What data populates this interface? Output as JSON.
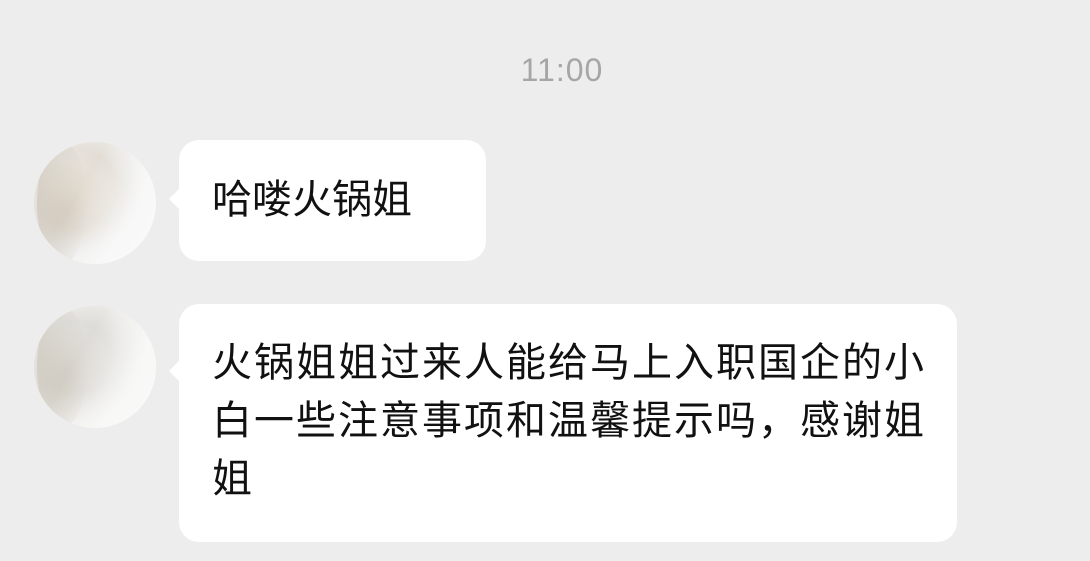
{
  "chat": {
    "timestamp": "11:00",
    "messages": [
      {
        "text": "哈喽火锅姐"
      },
      {
        "text": "火锅姐姐过来人能给马上入职国企的小白一些注意事项和温馨提示吗，感谢姐姐"
      }
    ]
  },
  "colors": {
    "background": "#ededed",
    "bubble": "#ffffff",
    "timestamp": "#a6a6a6",
    "text": "#111111"
  }
}
